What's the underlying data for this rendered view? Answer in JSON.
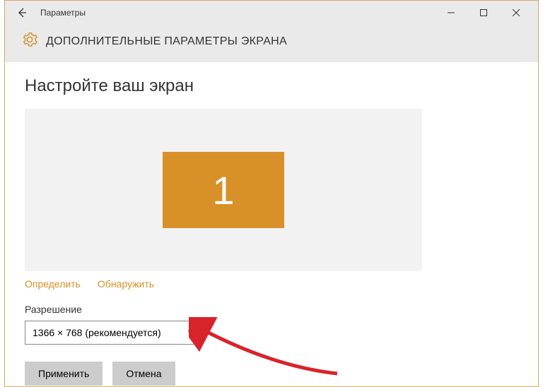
{
  "titlebar": {
    "app_title": "Параметры"
  },
  "header": {
    "title": "ДОПОЛНИТЕЛЬНЫЕ ПАРАМЕТРЫ ЭКРАНА"
  },
  "main": {
    "section_title": "Настройте ваш экран",
    "monitor_number": "1",
    "links": {
      "identify": "Определить",
      "detect": "Обнаружить"
    },
    "resolution": {
      "label": "Разрешение",
      "value": "1366 × 768 (рекомендуется)"
    },
    "buttons": {
      "apply": "Применить",
      "cancel": "Отмена"
    }
  }
}
